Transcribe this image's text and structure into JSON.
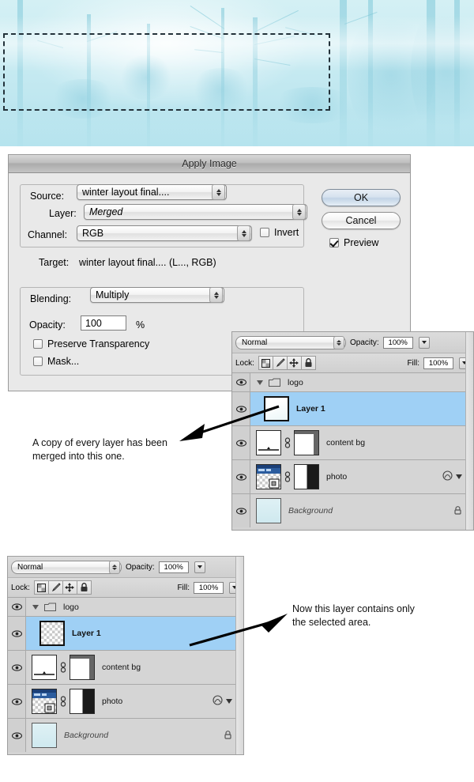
{
  "banner": {
    "name": "winter-forest-image",
    "marquee_label": "rectangular-selection-marquee"
  },
  "dialog": {
    "title": "Apply Image",
    "source_group_label": "Source:",
    "source_value": "winter layout final....",
    "layer_label": "Layer:",
    "layer_value": "Merged",
    "channel_label": "Channel:",
    "channel_value": "RGB",
    "invert_label": "Invert",
    "invert_checked": false,
    "target_label": "Target:",
    "target_value": "winter layout final.... (L..., RGB)",
    "blending_group_label": "Blending:",
    "blending_value": "Multiply",
    "opacity_label": "Opacity:",
    "opacity_value": "100",
    "percent_sign": "%",
    "preserve_transparency_label": "Preserve Transparency",
    "preserve_transparency_checked": false,
    "mask_label": "Mask...",
    "mask_checked": false,
    "ok_label": "OK",
    "cancel_label": "Cancel",
    "preview_label": "Preview",
    "preview_checked": true
  },
  "layers_panel_top": {
    "blend_mode": "Normal",
    "opacity_label": "Opacity:",
    "opacity_value": "100%",
    "lock_label": "Lock:",
    "fill_label": "Fill:",
    "fill_value": "100%",
    "lock_icons": [
      "lock-transparent-pixels-icon",
      "lock-image-pixels-icon",
      "lock-position-icon",
      "lock-all-icon"
    ],
    "rows": [
      {
        "name": "logo",
        "type": "group",
        "visible": true,
        "selected": false,
        "style": "normal"
      },
      {
        "name": "Layer 1",
        "type": "layer",
        "visible": true,
        "selected": true,
        "style": "bold",
        "thumb": "light"
      },
      {
        "name": "content bg",
        "type": "layer",
        "visible": true,
        "selected": false,
        "style": "normal",
        "thumb": "shape",
        "has_mask": true,
        "linked": true
      },
      {
        "name": "photo",
        "type": "layer",
        "visible": true,
        "selected": false,
        "style": "normal",
        "thumb": "photo",
        "has_mask": true,
        "linked": true,
        "has_effects": true
      },
      {
        "name": "Background",
        "type": "layer",
        "visible": true,
        "selected": false,
        "style": "italic",
        "thumb": "background",
        "locked": true
      }
    ]
  },
  "layers_panel_bottom": {
    "blend_mode": "Normal",
    "opacity_label": "Opacity:",
    "opacity_value": "100%",
    "lock_label": "Lock:",
    "fill_label": "Fill:",
    "fill_value": "100%",
    "lock_icons": [
      "lock-transparent-pixels-icon",
      "lock-image-pixels-icon",
      "lock-position-icon",
      "lock-all-icon"
    ],
    "rows": [
      {
        "name": "logo",
        "type": "group",
        "visible": true,
        "selected": false,
        "style": "normal"
      },
      {
        "name": "Layer 1",
        "type": "layer",
        "visible": true,
        "selected": true,
        "style": "bold",
        "thumb": "checker"
      },
      {
        "name": "content bg",
        "type": "layer",
        "visible": true,
        "selected": false,
        "style": "normal",
        "thumb": "shape",
        "has_mask": true,
        "linked": true
      },
      {
        "name": "photo",
        "type": "layer",
        "visible": true,
        "selected": false,
        "style": "normal",
        "thumb": "photo",
        "has_mask": true,
        "linked": true,
        "has_effects": true
      },
      {
        "name": "Background",
        "type": "layer",
        "visible": true,
        "selected": false,
        "style": "italic",
        "thumb": "background",
        "locked": true
      }
    ]
  },
  "annotations": {
    "first_line1": "A copy of every layer has been",
    "first_line2": "merged into this one.",
    "second_line1": "Now this layer contains only",
    "second_line2": "the selected area."
  },
  "colors": {
    "selection_blue": "#9fd0f5",
    "panel_gray": "#d3d3d3",
    "dialog_gray": "#e9e9e9",
    "winter_cyan": "#c8ebf2",
    "marquee_dash": "#23323a"
  }
}
